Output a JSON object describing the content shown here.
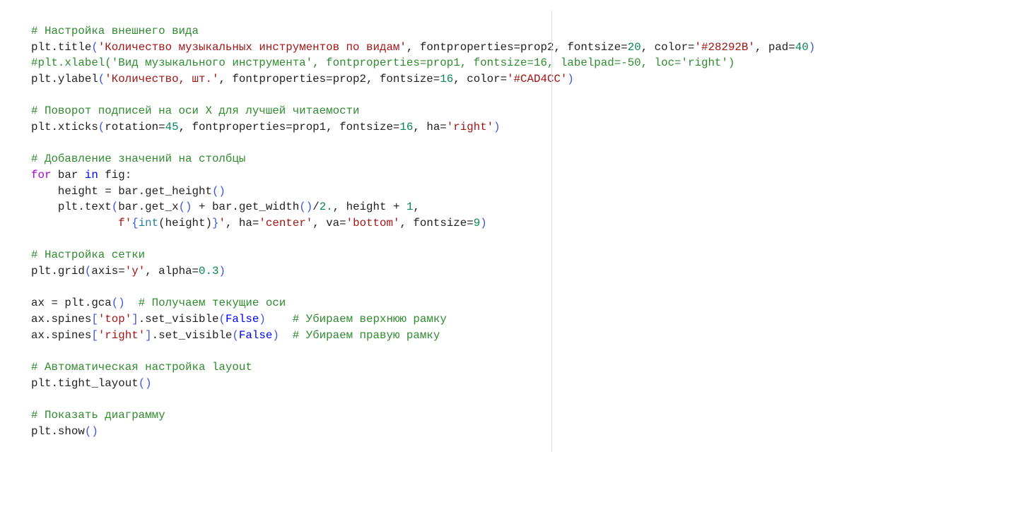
{
  "colors": {
    "comment": "#2e8b2e",
    "string": "#a31515",
    "number": "#098658",
    "keyword": "#af00db",
    "builtin_keyword": "#0000ff",
    "bracket": "#3a57d8"
  },
  "code": {
    "lines": [
      [
        [
          "c",
          "# Настройка внешнего вида"
        ]
      ],
      [
        [
          "d",
          "plt.title"
        ],
        [
          "p",
          "("
        ],
        [
          "s",
          "'Количество музыкальных инструментов по видам'"
        ],
        [
          "d",
          ", fontproperties=prop2, fontsize="
        ],
        [
          "n",
          "20"
        ],
        [
          "d",
          ", color="
        ],
        [
          "s",
          "'#28292B'"
        ],
        [
          "d",
          ", pad="
        ],
        [
          "n",
          "40"
        ],
        [
          "p",
          ")"
        ]
      ],
      [
        [
          "c",
          "#plt.xlabel('Вид музыкального инструмента', fontproperties=prop1, fontsize=16, labelpad=-50, loc='right')"
        ]
      ],
      [
        [
          "d",
          "plt.ylabel"
        ],
        [
          "p",
          "("
        ],
        [
          "s",
          "'Количество, шт.'"
        ],
        [
          "d",
          ", fontproperties=prop2, fontsize="
        ],
        [
          "n",
          "16"
        ],
        [
          "d",
          ", color="
        ],
        [
          "s",
          "'#CAD4CC'"
        ],
        [
          "p",
          ")"
        ]
      ],
      [],
      [
        [
          "c",
          "# Поворот подписей на оси X для лучшей читаемости"
        ]
      ],
      [
        [
          "d",
          "plt.xticks"
        ],
        [
          "p",
          "("
        ],
        [
          "d",
          "rotation="
        ],
        [
          "n",
          "45"
        ],
        [
          "d",
          ", fontproperties=prop1, fontsize="
        ],
        [
          "n",
          "16"
        ],
        [
          "d",
          ", ha="
        ],
        [
          "s",
          "'right'"
        ],
        [
          "p",
          ")"
        ]
      ],
      [],
      [
        [
          "c",
          "# Добавление значений на столбцы"
        ]
      ],
      [
        [
          "k",
          "for"
        ],
        [
          "d",
          " bar "
        ],
        [
          "b",
          "in"
        ],
        [
          "d",
          " fig:"
        ]
      ],
      [
        [
          "d",
          "    height = bar.get_height"
        ],
        [
          "p",
          "()"
        ]
      ],
      [
        [
          "d",
          "    plt.text"
        ],
        [
          "p",
          "("
        ],
        [
          "d",
          "bar.get_x"
        ],
        [
          "p",
          "()"
        ],
        [
          "d",
          " + bar.get_width"
        ],
        [
          "p",
          "()"
        ],
        [
          "d",
          "/"
        ],
        [
          "n",
          "2."
        ],
        [
          "d",
          ", height + "
        ],
        [
          "n",
          "1"
        ],
        [
          "d",
          ","
        ]
      ],
      [
        [
          "d",
          "             "
        ],
        [
          "s",
          "f'"
        ],
        [
          "p",
          "{"
        ],
        [
          "t",
          "int"
        ],
        [
          "d",
          "(height)"
        ],
        [
          "p",
          "}"
        ],
        [
          "s",
          "'"
        ],
        [
          "d",
          ", ha="
        ],
        [
          "s",
          "'center'"
        ],
        [
          "d",
          ", va="
        ],
        [
          "s",
          "'bottom'"
        ],
        [
          "d",
          ", fontsize="
        ],
        [
          "n",
          "9"
        ],
        [
          "p",
          ")"
        ]
      ],
      [],
      [
        [
          "c",
          "# Настройка сетки"
        ]
      ],
      [
        [
          "d",
          "plt.grid"
        ],
        [
          "p",
          "("
        ],
        [
          "d",
          "axis="
        ],
        [
          "s",
          "'y'"
        ],
        [
          "d",
          ", alpha="
        ],
        [
          "n",
          "0.3"
        ],
        [
          "p",
          ")"
        ]
      ],
      [],
      [
        [
          "d",
          "ax = plt.gca"
        ],
        [
          "p",
          "()"
        ],
        [
          "d",
          "  "
        ],
        [
          "c",
          "# Получаем текущие оси"
        ]
      ],
      [
        [
          "d",
          "ax.spines"
        ],
        [
          "p",
          "["
        ],
        [
          "s",
          "'top'"
        ],
        [
          "p",
          "]"
        ],
        [
          "d",
          ".set_visible"
        ],
        [
          "p",
          "("
        ],
        [
          "b",
          "False"
        ],
        [
          "p",
          ")"
        ],
        [
          "d",
          "    "
        ],
        [
          "c",
          "# Убираем верхнюю рамку"
        ]
      ],
      [
        [
          "d",
          "ax.spines"
        ],
        [
          "p",
          "["
        ],
        [
          "s",
          "'right'"
        ],
        [
          "p",
          "]"
        ],
        [
          "d",
          ".set_visible"
        ],
        [
          "p",
          "("
        ],
        [
          "b",
          "False"
        ],
        [
          "p",
          ")"
        ],
        [
          "d",
          "  "
        ],
        [
          "c",
          "# Убираем правую рамку"
        ]
      ],
      [],
      [
        [
          "c",
          "# Автоматическая настройка layout"
        ]
      ],
      [
        [
          "d",
          "plt.tight_layout"
        ],
        [
          "p",
          "()"
        ]
      ],
      [],
      [
        [
          "c",
          "# Показать диаграмму"
        ]
      ],
      [
        [
          "d",
          "plt.show"
        ],
        [
          "p",
          "()"
        ]
      ]
    ]
  }
}
